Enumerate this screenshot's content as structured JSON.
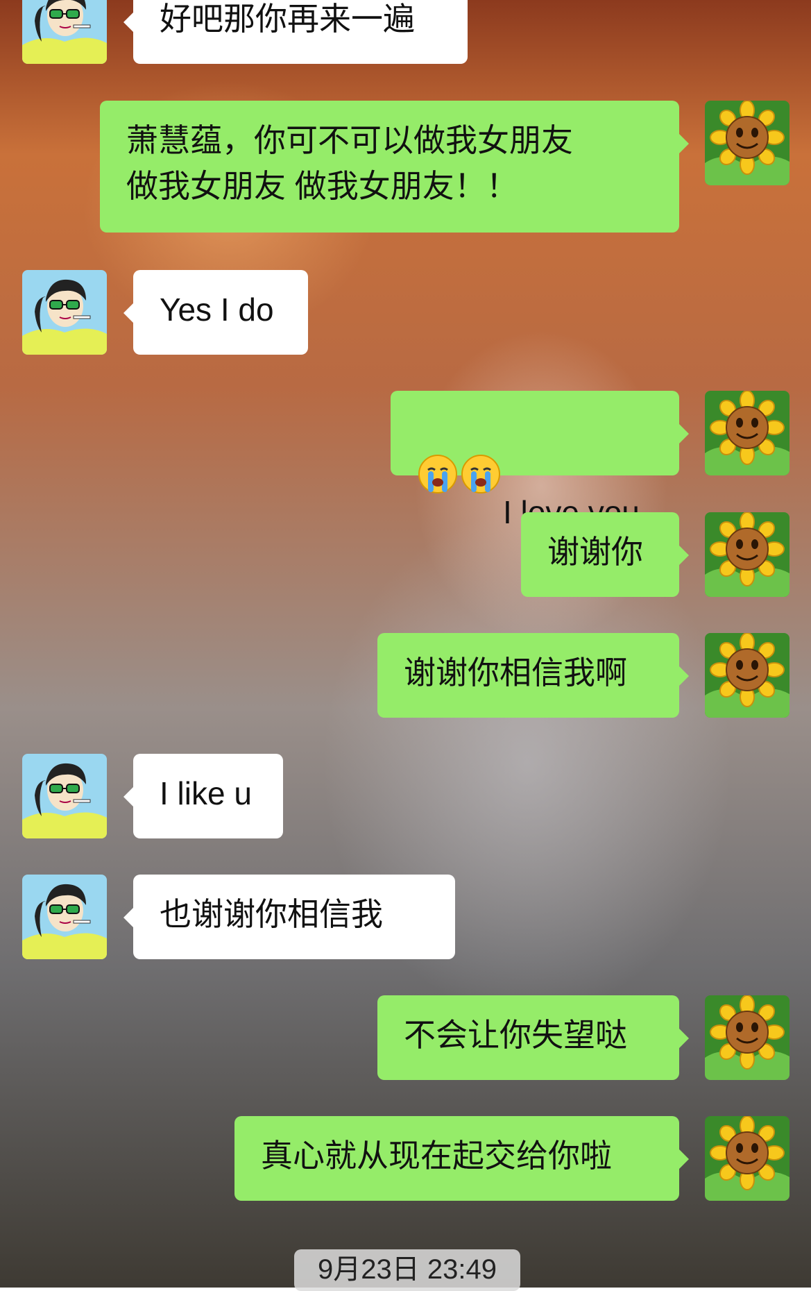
{
  "messages": [
    {
      "side": "in",
      "text": "好吧那你再来一遍"
    },
    {
      "side": "out",
      "text": "萧慧蕴，你可不可以做我女朋友\n做我女朋友 做我女朋友！！"
    },
    {
      "side": "in",
      "text": "Yes I do"
    },
    {
      "side": "out",
      "emoji": [
        "crying-face-emoji",
        "crying-face-emoji"
      ],
      "text": "I love you"
    },
    {
      "side": "out",
      "text": "谢谢你"
    },
    {
      "side": "out",
      "text": "谢谢你相信我啊"
    },
    {
      "side": "in",
      "text": "I like u"
    },
    {
      "side": "in",
      "text": "也谢谢你相信我"
    },
    {
      "side": "out",
      "text": "不会让你失望哒"
    },
    {
      "side": "out",
      "text": "真心就从现在起交给你啦"
    }
  ],
  "timestamp": "9月23日 23:49",
  "avatars": {
    "contact": "girl-with-green-glasses-avatar",
    "self": "sunflower-avatar"
  },
  "colors": {
    "incoming_bubble": "#ffffff",
    "outgoing_bubble": "#95ec69",
    "timestamp_bg": "#dcdcdc"
  }
}
